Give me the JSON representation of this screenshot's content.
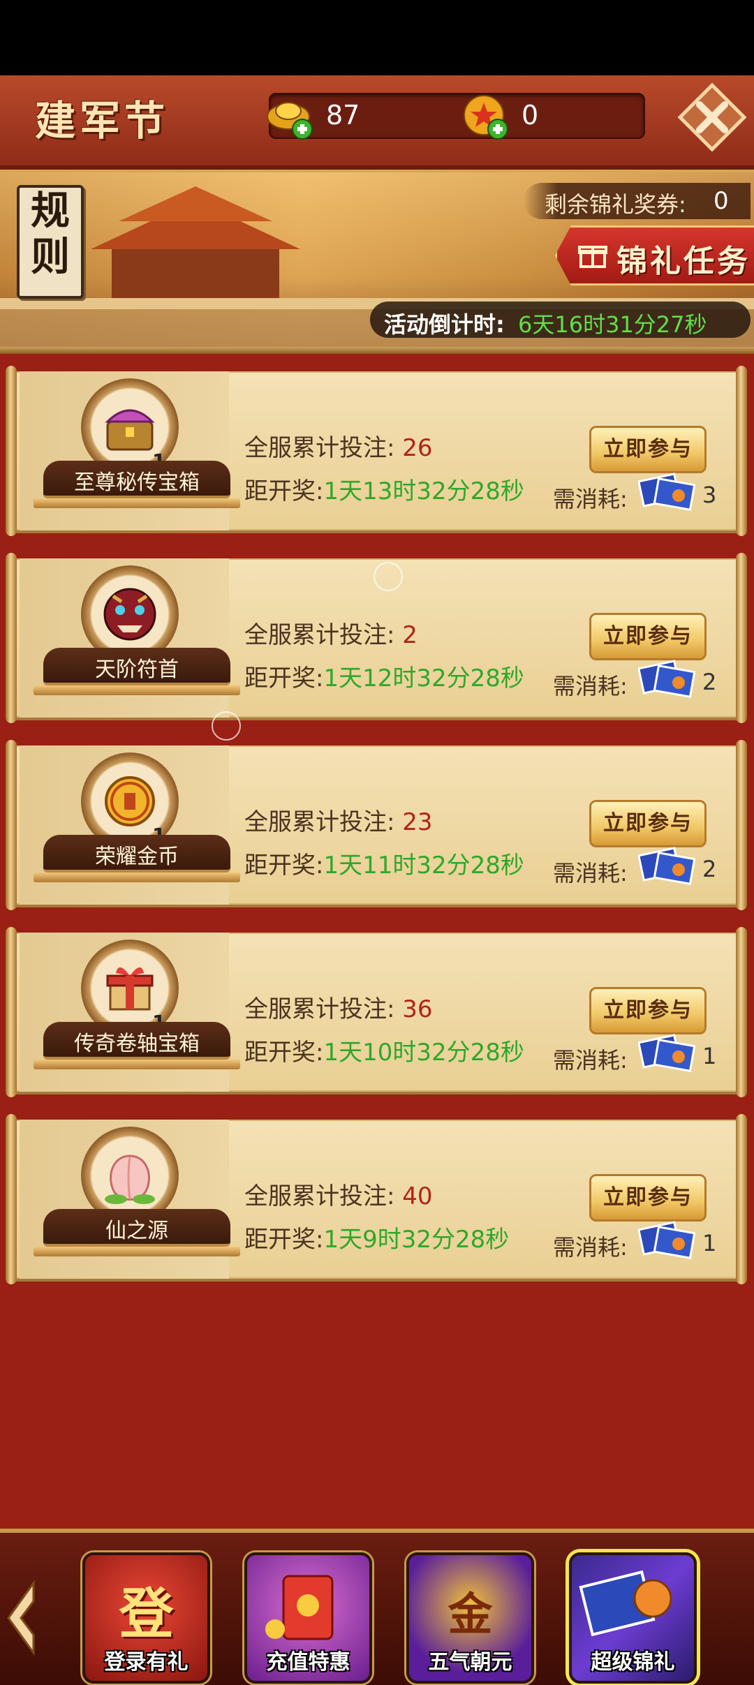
{
  "header": {
    "title": "建军节",
    "gold_amount": "87",
    "token_amount": "0"
  },
  "banner": {
    "rules_label_1": "规",
    "rules_label_2": "则",
    "remaining_label": "剩余锦礼奖券:",
    "remaining_value": "0",
    "gift_task_label": "锦礼任务",
    "countdown_label": "活动倒计时:",
    "countdown_value": "6天16时31分27秒"
  },
  "labels": {
    "bets_prefix": "全服累计投注:",
    "draw_prefix": "距开奖:",
    "join_button": "立即参与",
    "consume_prefix": "需消耗:"
  },
  "items": [
    {
      "name": "至尊秘传宝箱",
      "qty": "1",
      "bets": "26",
      "draw": "1天13时32分28秒",
      "cost": "3",
      "icon": "treasure-chest-icon"
    },
    {
      "name": "天阶符首",
      "qty": "",
      "bets": "2",
      "draw": "1天12时32分28秒",
      "cost": "2",
      "icon": "demon-mask-icon"
    },
    {
      "name": "荣耀金币",
      "qty": "1",
      "bets": "23",
      "draw": "1天11时32分28秒",
      "cost": "2",
      "icon": "gold-coin-icon"
    },
    {
      "name": "传奇卷轴宝箱",
      "qty": "1",
      "bets": "36",
      "draw": "1天10时32分28秒",
      "cost": "1",
      "icon": "gift-box-icon"
    },
    {
      "name": "仙之源",
      "qty": "",
      "bets": "40",
      "draw": "1天9时32分28秒",
      "cost": "1",
      "icon": "peach-icon"
    }
  ],
  "bottom_nav": {
    "login_label": "登录有礼",
    "login_glyph": "登",
    "recharge_label": "充值特惠",
    "wuqi_label": "五气朝元",
    "wuqi_glyph": "金",
    "super_label": "超级锦礼"
  },
  "colors": {
    "accent_red": "#9a1f14",
    "gold": "#f1c765",
    "countdown_green": "#5ee04a",
    "bets_red": "#b0231a",
    "draw_green": "#2ea82a"
  }
}
